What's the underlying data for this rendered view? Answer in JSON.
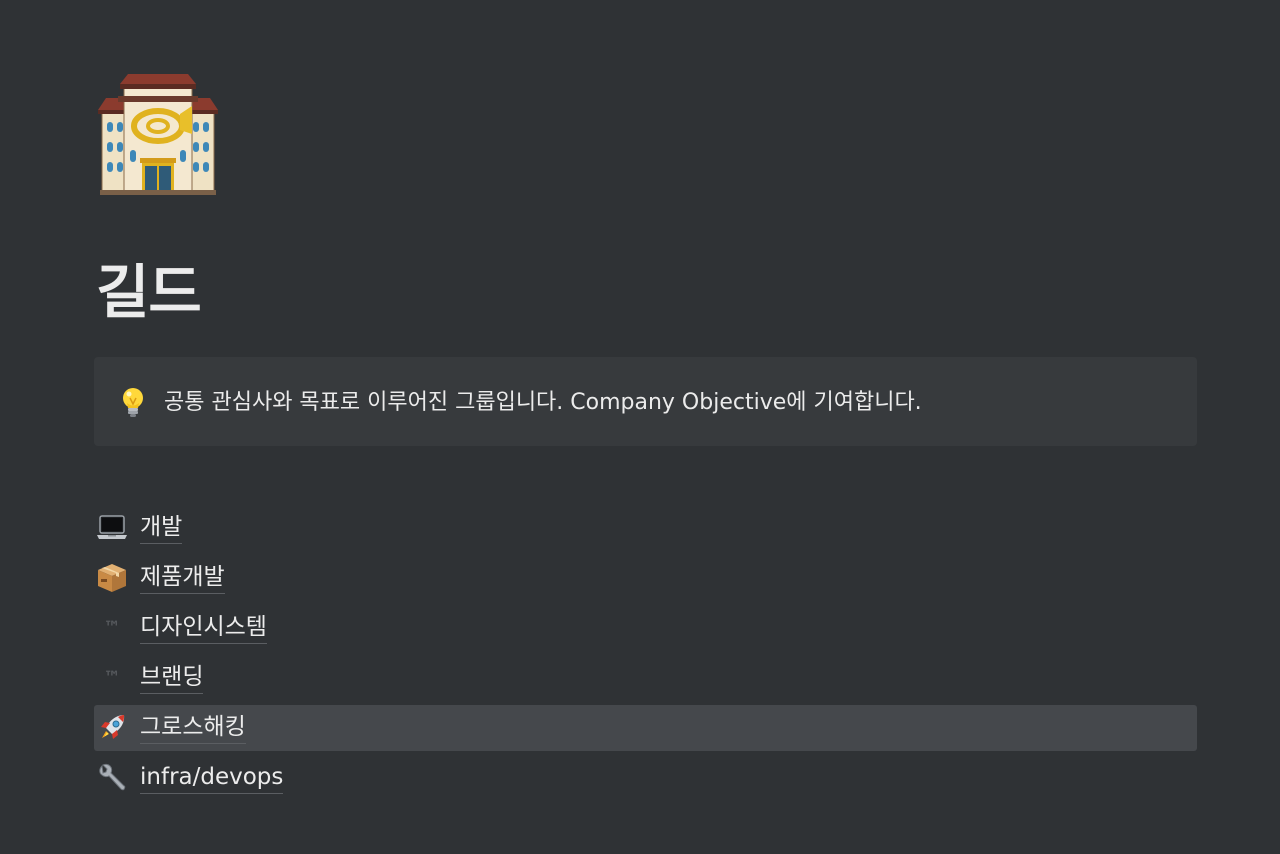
{
  "page": {
    "icon": "post-office-icon",
    "title": "길드"
  },
  "callout": {
    "icon": "lightbulb-icon",
    "text": "공통 관심사와 목표로 이루어진 그룹입니다. Company Objective에 기여합니다."
  },
  "links": [
    {
      "icon": "laptop-icon",
      "label": "개발"
    },
    {
      "icon": "package-icon",
      "label": "제품개발"
    },
    {
      "icon": "trademark-icon",
      "icon_glyph": "™",
      "label": "디자인시스템"
    },
    {
      "icon": "trademark-icon",
      "icon_glyph": "™",
      "label": "브랜딩"
    },
    {
      "icon": "rocket-icon",
      "label": "그로스해킹",
      "state": "hovered"
    },
    {
      "icon": "wrench-icon",
      "label": "infra/devops"
    }
  ],
  "colors": {
    "background": "#2f3235",
    "callout_background": "#373a3d",
    "hover_background": "#45484c",
    "text": "#ececec"
  }
}
